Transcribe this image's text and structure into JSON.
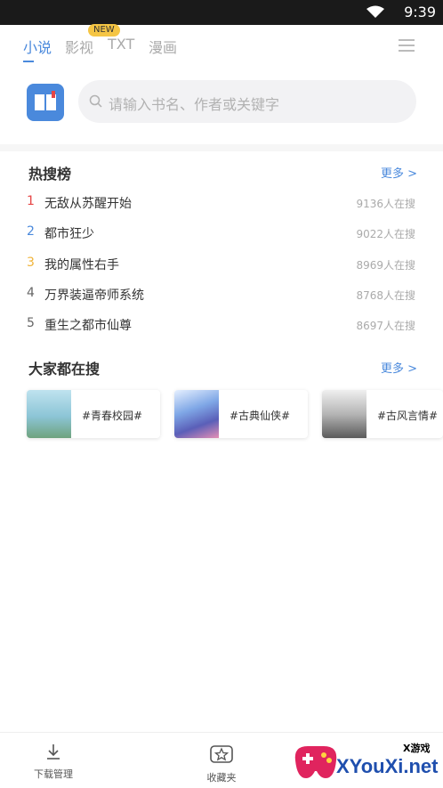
{
  "status_bar": {
    "time": "9:39"
  },
  "tabs": [
    {
      "label": "小说",
      "active": true
    },
    {
      "label": "影视",
      "active": false
    },
    {
      "label": "TXT",
      "active": false
    },
    {
      "label": "漫画",
      "active": false
    }
  ],
  "new_badge": "NEW",
  "search": {
    "placeholder": "请输入书名、作者或关键字"
  },
  "hot": {
    "title": "热搜榜",
    "more": "更多 >",
    "items": [
      {
        "rank": "1",
        "name": "无敌从苏醒开始",
        "count": "9136人在搜",
        "rank_color": "#e64545"
      },
      {
        "rank": "2",
        "name": "都市狂少",
        "count": "9022人在搜",
        "rank_color": "#4a89dc"
      },
      {
        "rank": "3",
        "name": "我的属性右手",
        "count": "8969人在搜",
        "rank_color": "#f0b43a"
      },
      {
        "rank": "4",
        "name": "万界装逼帝师系统",
        "count": "8768人在搜",
        "rank_color": "#666666"
      },
      {
        "rank": "5",
        "name": "重生之都市仙尊",
        "count": "8697人在搜",
        "rank_color": "#666666"
      }
    ]
  },
  "popular": {
    "title": "大家都在搜",
    "more": "更多 >",
    "tags": [
      "#青春校园#",
      "#古典仙侠#",
      "#古风言情#"
    ]
  },
  "bottom_nav": [
    {
      "label": "下载管理",
      "icon": "download-icon"
    },
    {
      "label": "收藏夹",
      "icon": "favorites-icon"
    }
  ],
  "watermark": {
    "brand": "XYouXi.net",
    "sub": "X游戏"
  },
  "colors": {
    "accent": "#4a89dc",
    "badge": "#f5c544"
  }
}
